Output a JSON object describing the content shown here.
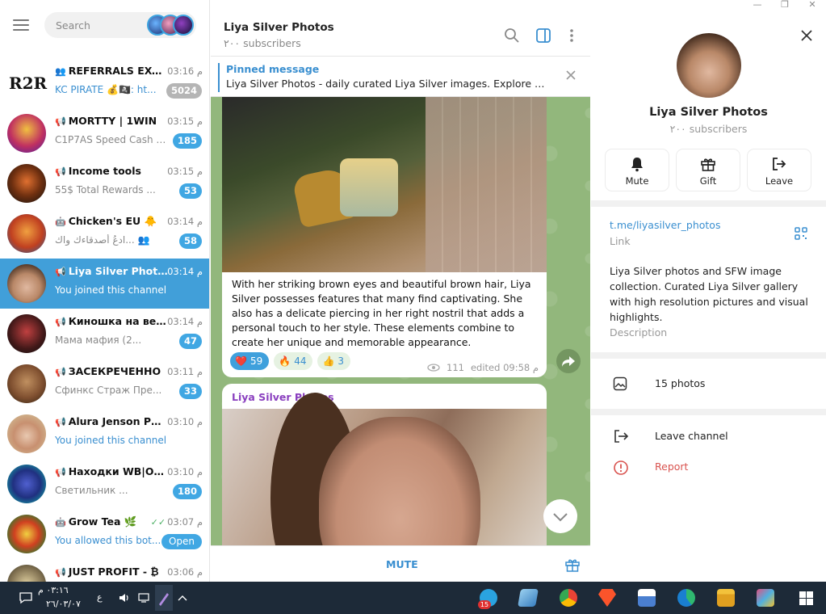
{
  "window": {
    "minimize": "—",
    "maximize": "❐",
    "close": "✕"
  },
  "sidebar": {
    "search_placeholder": "Search",
    "chats": [
      {
        "title": "REFERRALS EXC...",
        "time": "03:16 م",
        "preview": "KC PIRATE 💰🏴‍☠️: ht...",
        "badge": "5024",
        "icon": "group-icon"
      },
      {
        "title": "MORTTY | 1WIN",
        "time": "03:15 م",
        "preview": "C1P7AS Speed Cash XOF",
        "badge": "185",
        "icon": "megaphone-icon"
      },
      {
        "title": "Income tools",
        "time": "03:15 م",
        "preview": "55$ Total Rewards ...",
        "badge": "53",
        "icon": "megaphone-icon"
      },
      {
        "title": "Chicken's EU 🐥",
        "time": "03:14 م",
        "preview": "ادعُ أصدقاءك واك... 👥",
        "badge": "58",
        "icon": "bot-icon"
      },
      {
        "title": "Liya Silver Photos",
        "time": "03:14 م",
        "preview": "You joined this channel",
        "badge": "",
        "icon": "megaphone-icon"
      },
      {
        "title": "Киношка на веч...",
        "time": "03:14 م",
        "preview": "Мама мафия (2...",
        "badge": "47",
        "icon": "megaphone-icon"
      },
      {
        "title": "ЗАСЕКРЕЧЕННО",
        "time": "03:11 م",
        "preview": "Сфинкс Страж Пре...",
        "badge": "33",
        "icon": "megaphone-icon"
      },
      {
        "title": "Alura Jenson Ph...",
        "time": "03:10 م",
        "preview": "You joined this channel",
        "badge": "",
        "icon": "megaphone-icon"
      },
      {
        "title": "Находки WB|OZ...",
        "time": "03:10 م",
        "preview": "Светильник ...",
        "badge": "180",
        "icon": "megaphone-icon"
      },
      {
        "title": "Grow Tea 🌿",
        "time": "03:07 م",
        "preview": "You allowed this bot...",
        "badge": "Open",
        "icon": "bot-icon"
      },
      {
        "title": "JUST PROFIT - ₿",
        "time": "03:06 م",
        "preview": "",
        "badge": "",
        "icon": "megaphone-icon"
      }
    ]
  },
  "channel": {
    "name": "Liya Silver Photos",
    "subscribers": "٢٠٠ subscribers",
    "pinned_title": "Pinned message",
    "pinned_text": "Liya Silver Photos - daily curated Liya Silver images. Explore Liya ...",
    "message1": {
      "text": "With her striking brown eyes and beautiful brown hair, Liya Silver possesses features that many find captivating. She also has a delicate piercing in her right nostril that adds a personal touch to her style. These elements combine to create her unique and memorable appearance.",
      "reactions": [
        {
          "emoji": "❤️",
          "count": "59"
        },
        {
          "emoji": "🔥",
          "count": "44"
        },
        {
          "emoji": "👍",
          "count": "3"
        }
      ],
      "views": "111",
      "edited": "edited 09:58 م"
    },
    "message2_author": "Liya Silver Photos",
    "footer_button": "MUTE"
  },
  "profile": {
    "name": "Liya Silver Photos",
    "subscribers": "٢٠٠ subscribers",
    "actions": [
      "Mute",
      "Gift",
      "Leave"
    ],
    "link": "t.me/liyasilver_photos",
    "link_label": "Link",
    "description": "Liya Silver photos and SFW image collection. Curated Liya Silver gallery with high resolution pictures and visual highlights.",
    "description_label": "Description",
    "media": "15 photos",
    "leave": "Leave channel",
    "report": "Report"
  },
  "taskbar": {
    "time": "٠٣:١٦ م",
    "date": "٢٦/٠٣/٠٧",
    "lang": "ع",
    "telegram_badge": "15"
  },
  "colors": {
    "accent": "#40a7e3",
    "active_chat": "#419fd9",
    "chat_bg": "#8fb47a",
    "report": "#d9534f",
    "taskbar": "#1d2a38"
  }
}
